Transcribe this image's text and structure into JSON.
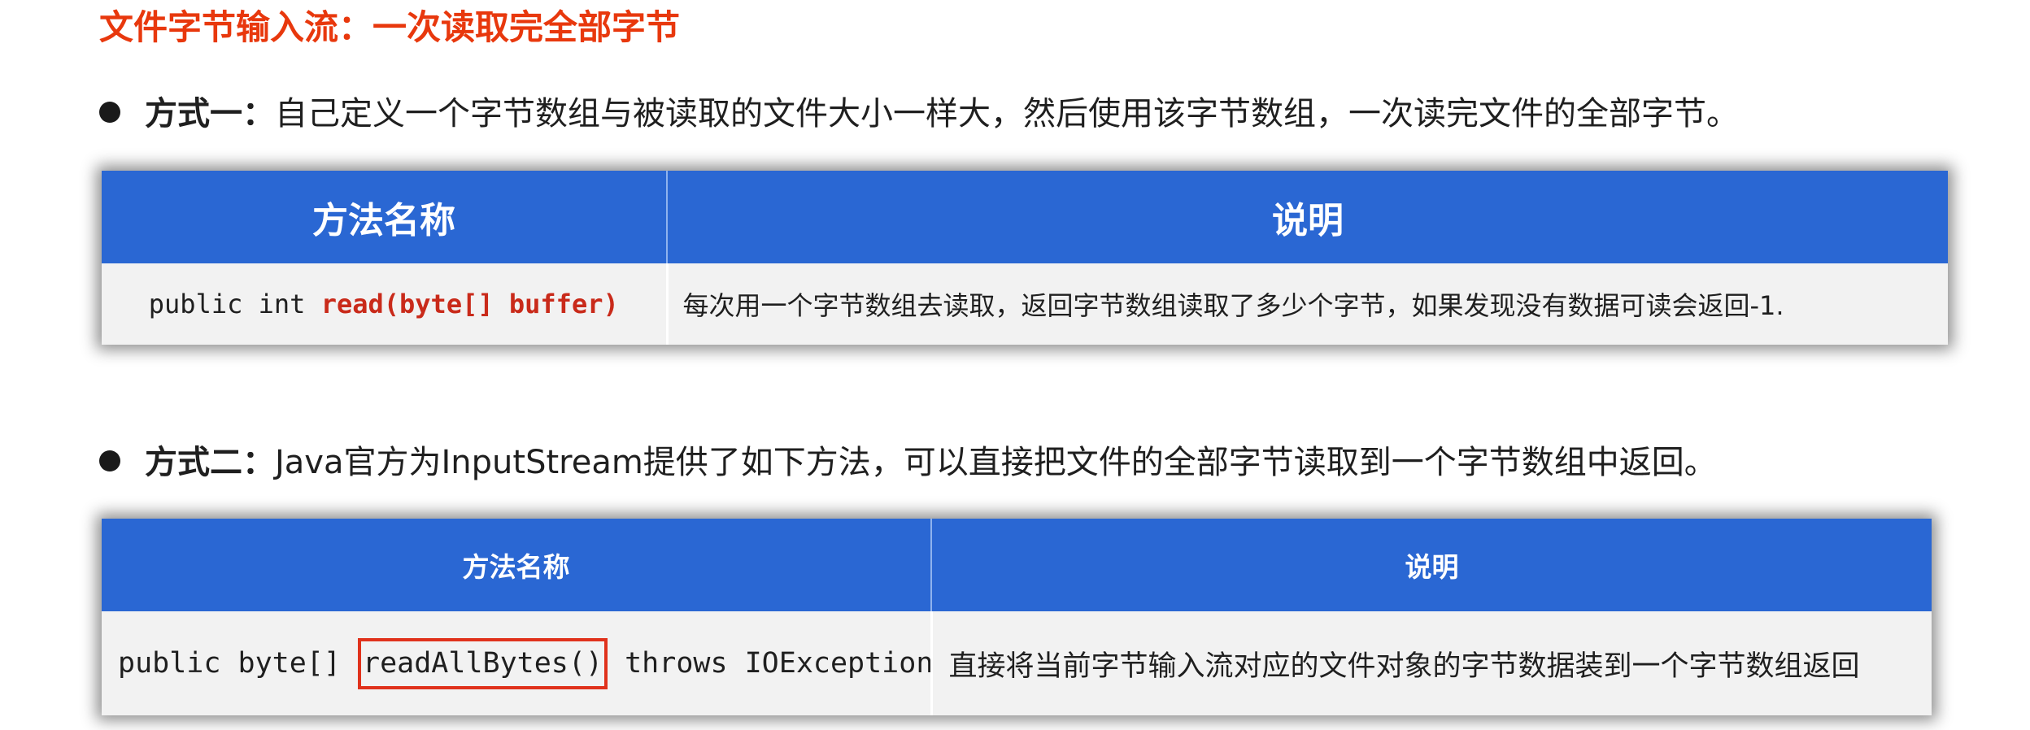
{
  "title": "文件字节输入流：一次读取完全部字节",
  "section1": {
    "lead": "方式一：",
    "text": "自己定义一个字节数组与被读取的文件大小一样大，然后使用该字节数组，一次读完文件的全部字节。",
    "table": {
      "headers": [
        "方法名称",
        "说明"
      ],
      "row": {
        "code_prefix": "public int ",
        "code_method": "read(byte[] buffer)",
        "description": "每次用一个字节数组去读取，返回字节数组读取了多少个字节，如果发现没有数据可读会返回-1."
      }
    }
  },
  "section2": {
    "lead": "方式二：",
    "text": "Java官方为InputStream提供了如下方法，可以直接把文件的全部字节读取到一个字节数组中返回。",
    "table": {
      "headers": [
        "方法名称",
        "说明"
      ],
      "row": {
        "code_prefix": "public byte[] ",
        "code_method": "readAllBytes()",
        "code_suffix": " throws IOException",
        "description": "直接将当前字节输入流对应的文件对象的字节数据装到一个字节数组返回"
      }
    }
  },
  "colors": {
    "title": "#e8380d",
    "header_bg": "#2a67d3",
    "highlight_box": "#e0321c",
    "method_red": "#c92a1a"
  }
}
